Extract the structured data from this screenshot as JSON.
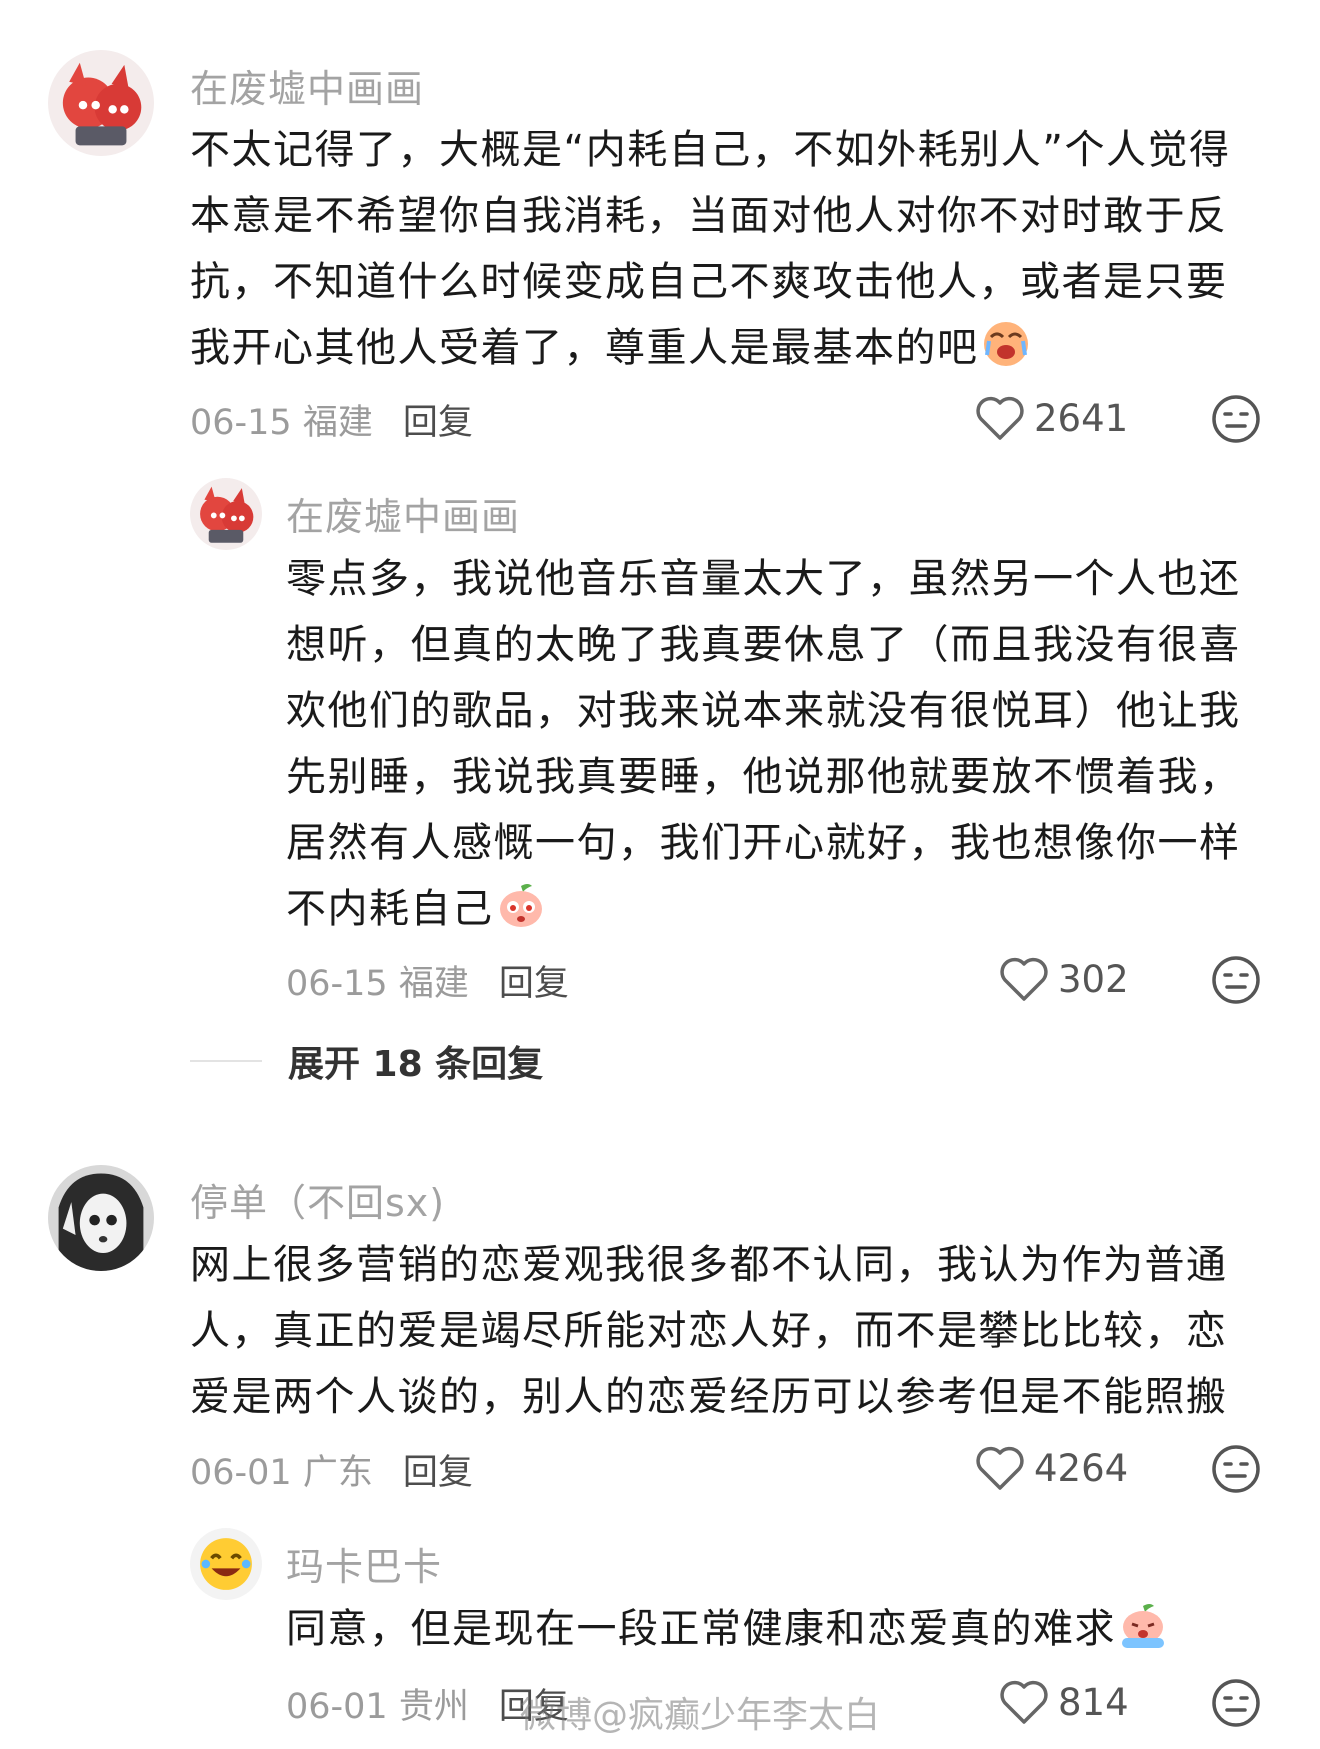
{
  "comments": [
    {
      "username": "在废墟中画画",
      "text": "不太记得了，大概是“内耗自己，不如外耗别人”个人觉得本意是不希望你自我消耗，当面对他人对你不对时敢于反抗，不知道什么时候变成自己不爽攻击他人，或者是只要我开心其他人受着了，尊重人是最基本的吧",
      "date_location": "06-15 福建",
      "reply_label": "回复",
      "likes": "2641",
      "emoji": "crying-face-emoji"
    },
    {
      "username": "在废墟中画画",
      "text": "零点多，我说他音乐音量太大了，虽然另一个人也还想听，但真的太晚了我真要休息了（而且我没有很喜欢他们的歌品，对我来说本来就没有很悦耳）他让我先别睡，我说我真要睡，他说那他就要放不惯着我，居然有人感慨一句，我们开心就好，我也想像你一样不内耗自己",
      "date_location": "06-15 福建",
      "reply_label": "回复",
      "likes": "302",
      "emoji": "pleading-peach-emoji"
    },
    {
      "username": "停单（不回sx)",
      "text": "网上很多营销的恋爱观我很多都不认同，我认为作为普通人，真正的爱是竭尽所能对恋人好，而不是攀比比较，恋爱是两个人谈的，别人的恋爱经历可以参考但是不能照搬",
      "date_location": "06-01 广东",
      "reply_label": "回复",
      "likes": "4264"
    },
    {
      "username": "玛卡巴卡",
      "text": "同意，但是现在一段正常健康和恋爱真的难求",
      "date_location": "06-01 贵州",
      "reply_label": "回复",
      "likes": "814",
      "emoji": "sobbing-peach-emoji"
    }
  ],
  "expand_replies": "展开 18 条回复",
  "watermark": "微博@疯癫少年李太白",
  "colors": {
    "text": "#1a1a1a",
    "muted": "#9b9b9b",
    "username": "#a3a3a3"
  }
}
